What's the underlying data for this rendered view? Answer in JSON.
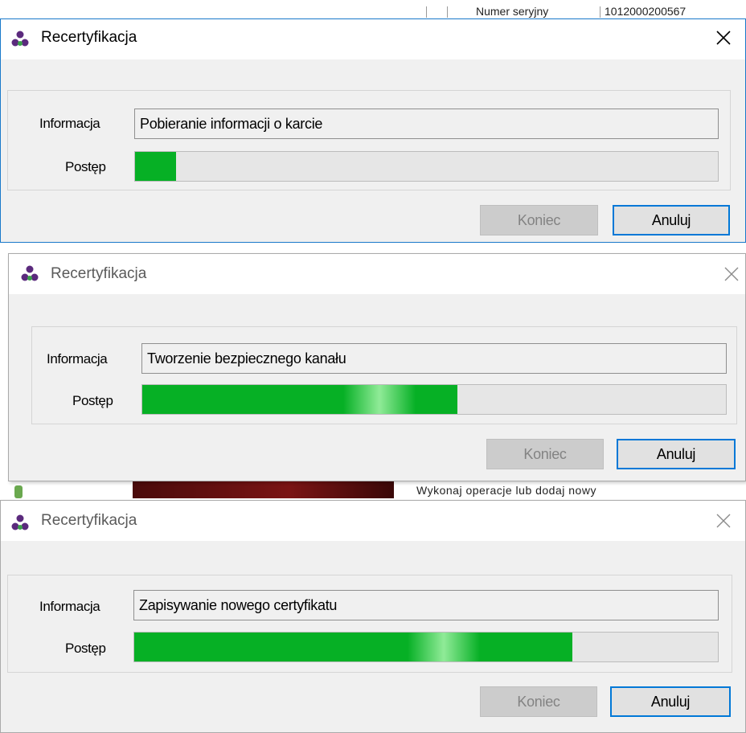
{
  "background": {
    "top_label": "Numer seryjny",
    "top_value": "1012000200567",
    "mid_text": "Wykonaj operacje lub dodaj nowy"
  },
  "dialogs": [
    {
      "title": "Recertyfikacja",
      "info_label": "Informacja",
      "info_value": "Pobieranie informacji o karcie",
      "progress_label": "Postęp",
      "progress_percent": 7,
      "finish_button": "Koniec",
      "cancel_button": "Anuluj",
      "state": "active"
    },
    {
      "title": "Recertyfikacja",
      "info_label": "Informacja",
      "info_value": "Tworzenie bezpiecznego kanału",
      "progress_label": "Postęp",
      "progress_percent": 54,
      "finish_button": "Koniec",
      "cancel_button": "Anuluj",
      "state": "inactive"
    },
    {
      "title": "Recertyfikacja",
      "info_label": "Informacja",
      "info_value": "Zapisywanie nowego certyfikatu",
      "progress_label": "Postęp",
      "progress_percent": 75,
      "finish_button": "Koniec",
      "cancel_button": "Anuluj",
      "state": "inactive"
    }
  ],
  "colors": {
    "progress_fill": "#06b025",
    "active_border": "#1979ca",
    "default_button_border": "#0078d7"
  },
  "icons": {
    "app": "app-icon-purple-green-circles",
    "close": "close-icon"
  }
}
